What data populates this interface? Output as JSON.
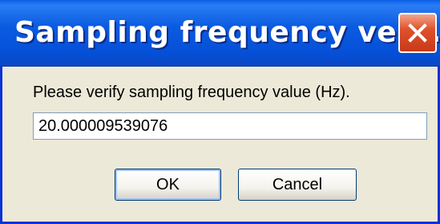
{
  "window": {
    "title": "Sampling frequency ver..."
  },
  "dialog": {
    "prompt": "Please verify sampling frequency value (Hz).",
    "value": "20.000009539076",
    "ok_label": "OK",
    "cancel_label": "Cancel"
  },
  "icons": {
    "close": "close-icon"
  },
  "colors": {
    "titlebar": "#0550D8",
    "close_button": "#E0522B",
    "body": "#ECE9D8"
  }
}
